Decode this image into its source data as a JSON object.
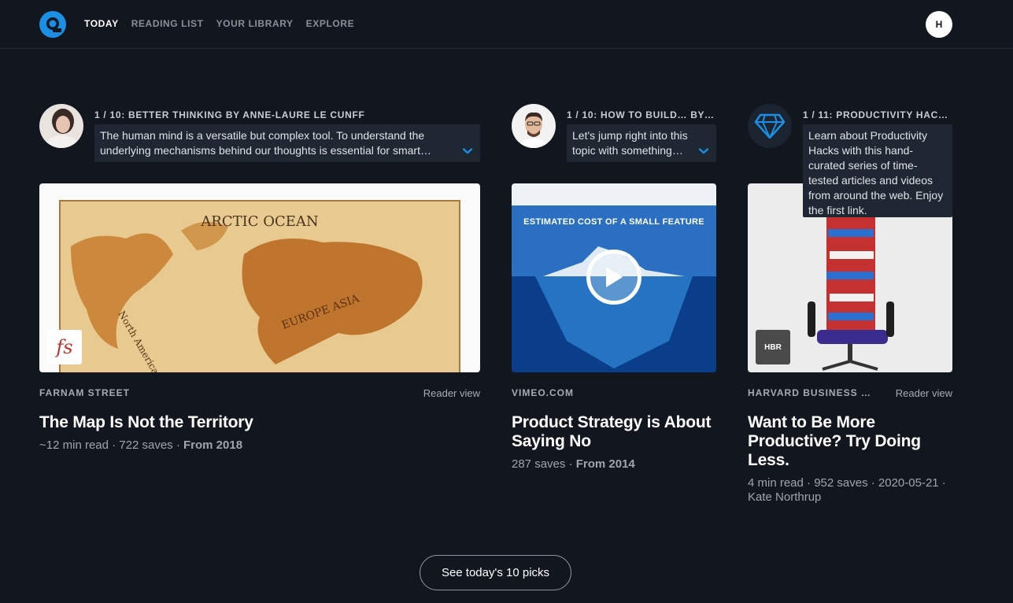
{
  "nav": {
    "items": [
      "TODAY",
      "READING LIST",
      "YOUR LIBRARY",
      "EXPLORE"
    ],
    "active": "TODAY"
  },
  "user": {
    "initial": "H"
  },
  "colors": {
    "background": "#12161e",
    "accent": "#1a8fe3",
    "panel": "#1f2733"
  },
  "columns": [
    {
      "curator_title": "1 / 10: BETTER THINKING BY ANNE-LAURE LE CUNFF",
      "curator_desc": "The human mind is a versatile but complex tool. To understand the underlying mechanisms behind our thoughts is essential for smart…",
      "image_badge": "fs",
      "source": "FARNAM STREET",
      "reader_view": "Reader view",
      "title": "The Map Is Not the Territory",
      "meta_plain": "~12 min read · 722 saves · ",
      "meta_bold": "From 2018"
    },
    {
      "curator_title": "1 / 10: HOW TO BUILD… BY …",
      "curator_desc": "Let's jump right into this topic with something…",
      "image_caption": "ESTIMATED COST OF A SMALL FEATURE",
      "source": "VIMEO.COM",
      "title": "Product Strategy is About Saying No",
      "meta_plain": "287 saves · ",
      "meta_bold": "From 2014"
    },
    {
      "curator_title": "1 / 11: PRODUCTIVITY HAC…",
      "curator_desc": "Learn about Productivity Hacks with this hand-curated series of time-tested articles and videos from around the web. Enjoy the first link.",
      "image_badge": "HBR",
      "source": "HARVARD BUSINESS …",
      "reader_view": "Reader view",
      "title": "Want to Be More Productive? Try Doing Less.",
      "meta_plain": "4 min read · 952 saves · 2020-05-21 · Kate Northrup"
    }
  ],
  "footer": {
    "picks_label": "See today's 10 picks"
  }
}
